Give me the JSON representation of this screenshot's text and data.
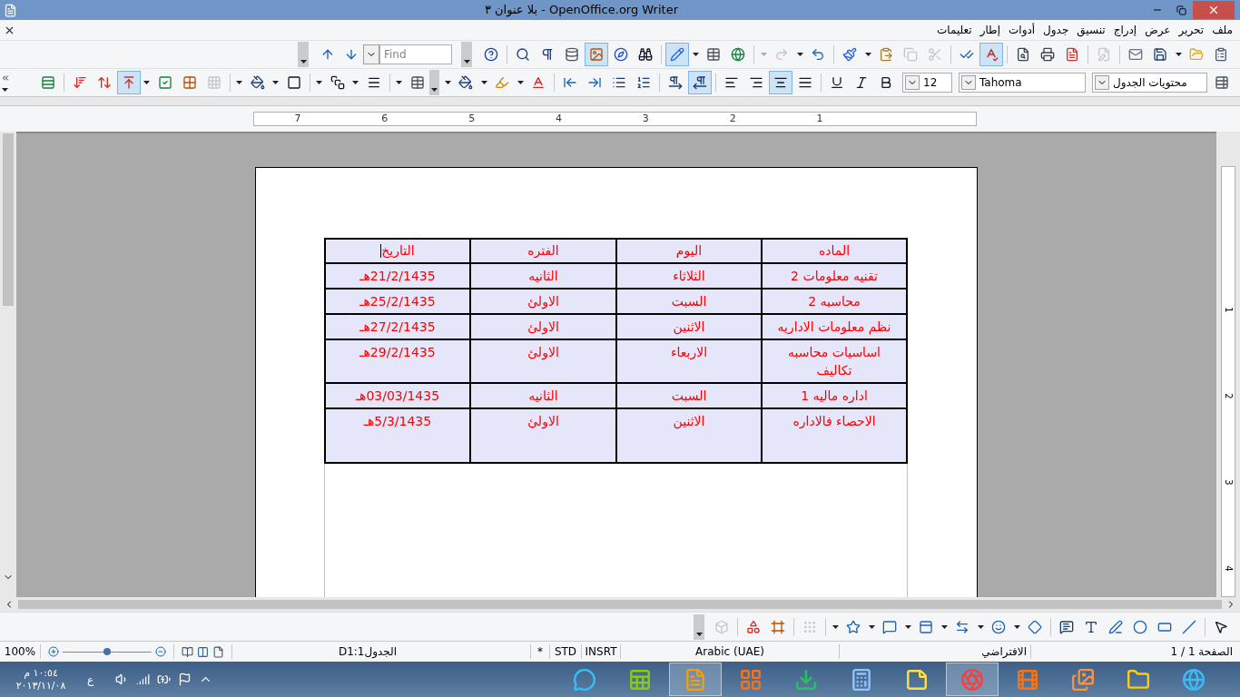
{
  "window": {
    "title": "بلا عنوان ٣ - OpenOffice.org Writer"
  },
  "menu": [
    "ملف",
    "تحرير",
    "عرض",
    "إدراج",
    "تنسيق",
    "جدول",
    "أدوات",
    "إطار",
    "تعليمات"
  ],
  "standard_toolbar": {
    "groups": [
      [
        {
          "kind": "clipboard-list",
          "selected": false,
          "disabled": false
        },
        {
          "kind": "folder-open",
          "selected": false,
          "disabled": false
        },
        {
          "kind": "caret",
          "selected": false,
          "disabled": false
        },
        {
          "kind": "floppy-disk",
          "selected": false,
          "disabled": false
        },
        {
          "kind": "envelope",
          "selected": false,
          "disabled": false
        }
      ],
      [
        {
          "kind": "file-pen",
          "selected": false,
          "disabled": true
        }
      ],
      [
        {
          "kind": "pdf-file",
          "selected": false,
          "disabled": false
        },
        {
          "kind": "printer",
          "selected": false,
          "disabled": false
        },
        {
          "kind": "file-search",
          "selected": false,
          "disabled": false
        }
      ],
      [
        {
          "kind": "spell-check-wave",
          "selected": true,
          "disabled": false
        },
        {
          "kind": "check-marks",
          "selected": false,
          "disabled": false
        }
      ],
      [
        {
          "kind": "scissors",
          "selected": false,
          "disabled": true
        },
        {
          "kind": "copy",
          "selected": false,
          "disabled": true
        },
        {
          "kind": "clipboard-paste",
          "selected": false,
          "disabled": false
        },
        {
          "kind": "caret",
          "selected": false,
          "disabled": false
        },
        {
          "kind": "paintbrush",
          "selected": false,
          "disabled": false
        }
      ],
      [
        {
          "kind": "undo",
          "selected": false,
          "disabled": false
        },
        {
          "kind": "caret",
          "selected": false,
          "disabled": false
        },
        {
          "kind": "redo",
          "selected": false,
          "disabled": true
        },
        {
          "kind": "caret",
          "selected": false,
          "disabled": true
        }
      ],
      [
        {
          "kind": "globe",
          "selected": false,
          "disabled": false
        },
        {
          "kind": "table-grid",
          "selected": false,
          "disabled": false
        },
        {
          "kind": "caret",
          "selected": false,
          "disabled": false
        },
        {
          "kind": "pencil",
          "selected": true,
          "disabled": false
        }
      ],
      [
        {
          "kind": "binoculars",
          "selected": false,
          "disabled": false
        },
        {
          "kind": "compass",
          "selected": false,
          "disabled": false
        },
        {
          "kind": "picture",
          "selected": true,
          "disabled": false
        },
        {
          "kind": "database",
          "selected": false,
          "disabled": false
        },
        {
          "kind": "pilcrow",
          "selected": false,
          "disabled": false
        },
        {
          "kind": "magnifier",
          "selected": false,
          "disabled": false
        }
      ],
      [
        {
          "kind": "help",
          "selected": false,
          "disabled": false
        }
      ]
    ]
  },
  "find_toolbar": {
    "placeholder": "Find"
  },
  "formatting_toolbar": {
    "style": "محتويات الجدول",
    "font": "Tahoma",
    "size": "12",
    "groups": [
      [
        {
          "kind": "bold",
          "selected": false,
          "disabled": false
        },
        {
          "kind": "italic",
          "selected": false,
          "disabled": false
        },
        {
          "kind": "underline",
          "selected": false,
          "disabled": false
        }
      ],
      [
        {
          "kind": "align-justify",
          "selected": false,
          "disabled": false
        },
        {
          "kind": "align-center",
          "selected": true,
          "disabled": false
        },
        {
          "kind": "align-right",
          "selected": false,
          "disabled": false
        },
        {
          "kind": "align-left",
          "selected": false,
          "disabled": false
        }
      ],
      [
        {
          "kind": "pilcrow-left",
          "selected": true,
          "disabled": false
        },
        {
          "kind": "pilcrow-right",
          "selected": false,
          "disabled": false
        }
      ],
      [
        {
          "kind": "list-ordered",
          "selected": false,
          "disabled": false
        },
        {
          "kind": "list",
          "selected": false,
          "disabled": false
        },
        {
          "kind": "indent-right",
          "selected": false,
          "disabled": false
        },
        {
          "kind": "indent-left",
          "selected": false,
          "disabled": false
        }
      ],
      [
        {
          "kind": "font-color",
          "selected": false,
          "disabled": false
        },
        {
          "kind": "caret",
          "selected": false,
          "disabled": false
        },
        {
          "kind": "highlighter",
          "selected": false,
          "disabled": false
        },
        {
          "kind": "caret",
          "selected": false,
          "disabled": false
        },
        {
          "kind": "paint-bucket",
          "selected": false,
          "disabled": false
        },
        {
          "kind": "caret",
          "selected": false,
          "disabled": false
        }
      ]
    ]
  },
  "table_toolbar": {
    "groups": [
      [
        {
          "kind": "rows-grid",
          "selected": false,
          "disabled": false
        }
      ],
      [
        {
          "kind": "sort-down",
          "selected": false,
          "disabled": false
        },
        {
          "kind": "sort-up-down",
          "selected": false,
          "disabled": false
        },
        {
          "kind": "align-top",
          "selected": true,
          "disabled": false
        },
        {
          "kind": "caret",
          "selected": false,
          "disabled": false
        },
        {
          "kind": "table-check",
          "selected": false,
          "disabled": false
        },
        {
          "kind": "merge-cells",
          "selected": false,
          "disabled": false
        },
        {
          "kind": "split-cells",
          "selected": false,
          "disabled": true
        }
      ],
      [
        {
          "kind": "caret",
          "selected": false,
          "disabled": false
        },
        {
          "kind": "paint-bucket",
          "selected": false,
          "disabled": false
        },
        {
          "kind": "caret",
          "selected": false,
          "disabled": false
        },
        {
          "kind": "square",
          "selected": false,
          "disabled": false
        }
      ],
      [
        {
          "kind": "caret",
          "selected": false,
          "disabled": false
        },
        {
          "kind": "square-stack",
          "selected": false,
          "disabled": false
        },
        {
          "kind": "caret",
          "selected": false,
          "disabled": false
        },
        {
          "kind": "horizontal-lines",
          "selected": false,
          "disabled": false
        }
      ],
      [
        {
          "kind": "caret",
          "selected": false,
          "disabled": false
        },
        {
          "kind": "table-grid",
          "selected": false,
          "disabled": false
        }
      ]
    ]
  },
  "ruler": {
    "labels": [
      "1",
      "2",
      "3",
      "4",
      "5",
      "6",
      "7"
    ]
  },
  "vertical_ruler": {
    "labels": [
      "1",
      "2",
      "3",
      "4"
    ]
  },
  "table": {
    "columns": [
      "الماده",
      "اليوم",
      "الفتره",
      "التاريخ"
    ],
    "rows": [
      [
        "تقنيه معلومات 2",
        "الثلاثاء",
        "الثانيه",
        "21/2/1435هـ"
      ],
      [
        "محاسبه 2",
        "السبت",
        "الاولئ",
        "25/2/1435هـ"
      ],
      [
        "نظم معلومات الاداريه",
        "الاثنين",
        "الاولئ",
        "27/2/1435هـ"
      ],
      [
        "اساسيات محاسبه تكاليف",
        "الاربعاء",
        "الاولئ",
        "29/2/1435هـ"
      ],
      [
        "اداره ماليه 1",
        "السبت",
        "الثانيه",
        "03/03/1435هـ"
      ],
      [
        "الاحصاء فالاداره",
        "الاثنين",
        "الاولئ",
        "5/3/1435هـ"
      ]
    ]
  },
  "drawing_toolbar": {
    "groups": [
      [
        {
          "kind": "pointer",
          "selected": false,
          "disabled": false
        }
      ],
      [
        {
          "kind": "line",
          "selected": false,
          "disabled": false
        },
        {
          "kind": "rectangle",
          "selected": false,
          "disabled": false
        },
        {
          "kind": "ellipse",
          "selected": false,
          "disabled": false
        },
        {
          "kind": "freehand",
          "selected": false,
          "disabled": false
        },
        {
          "kind": "text-t",
          "selected": false,
          "disabled": false
        },
        {
          "kind": "callout",
          "selected": false,
          "disabled": false
        }
      ],
      [
        {
          "kind": "diamond",
          "selected": false,
          "disabled": false
        },
        {
          "kind": "caret",
          "selected": false,
          "disabled": false
        },
        {
          "kind": "smiley",
          "selected": false,
          "disabled": false
        },
        {
          "kind": "caret",
          "selected": false,
          "disabled": false
        },
        {
          "kind": "double-arrow",
          "selected": false,
          "disabled": false
        },
        {
          "kind": "caret",
          "selected": false,
          "disabled": false
        },
        {
          "kind": "flowchart",
          "selected": false,
          "disabled": false
        },
        {
          "kind": "caret",
          "selected": false,
          "disabled": false
        },
        {
          "kind": "speech-bubble",
          "selected": false,
          "disabled": false
        },
        {
          "kind": "caret",
          "selected": false,
          "disabled": false
        },
        {
          "kind": "star",
          "selected": false,
          "disabled": false
        },
        {
          "kind": "caret",
          "selected": false,
          "disabled": false
        }
      ],
      [
        {
          "kind": "dotted-points",
          "selected": false,
          "disabled": true
        }
      ],
      [
        {
          "kind": "text-frame",
          "selected": false,
          "disabled": false
        },
        {
          "kind": "shapes",
          "selected": false,
          "disabled": false
        }
      ],
      [
        {
          "kind": "extrusion",
          "selected": false,
          "disabled": true
        }
      ]
    ]
  },
  "status_bar": {
    "zoom": "100%",
    "zoom_slider": {
      "level": 0.5
    },
    "cell": "D1:1الجدول",
    "modified": "*",
    "selection_mode": "STD",
    "insert_mode": "INSRT",
    "language": "Arabic (UAE)",
    "page_style": "الافتراضي",
    "page": "الصفحة 1 / 1"
  },
  "taskbar": {
    "clock_time": "١٠:٥٤ م",
    "clock_date": "٢٠١٣/١١/٠٨",
    "input_language": "ع",
    "tray": [
      {
        "kind": "speaker"
      },
      {
        "kind": "signal"
      },
      {
        "kind": "battery"
      },
      {
        "kind": "flag"
      },
      {
        "kind": "up-caret"
      }
    ],
    "apps": [
      {
        "kind": "chat-bubble",
        "selected": false
      },
      {
        "kind": "spreadsheet",
        "selected": false
      },
      {
        "kind": "document",
        "selected": true
      },
      {
        "kind": "window-flag",
        "selected": false
      },
      {
        "kind": "download-arrow",
        "selected": false
      },
      {
        "kind": "calculator",
        "selected": false
      },
      {
        "kind": "sticky-note",
        "selected": false
      },
      {
        "kind": "aperture",
        "selected": true
      },
      {
        "kind": "film",
        "selected": false
      },
      {
        "kind": "photos",
        "selected": false
      },
      {
        "kind": "folder",
        "selected": false
      },
      {
        "kind": "globe-e",
        "selected": false
      }
    ]
  }
}
